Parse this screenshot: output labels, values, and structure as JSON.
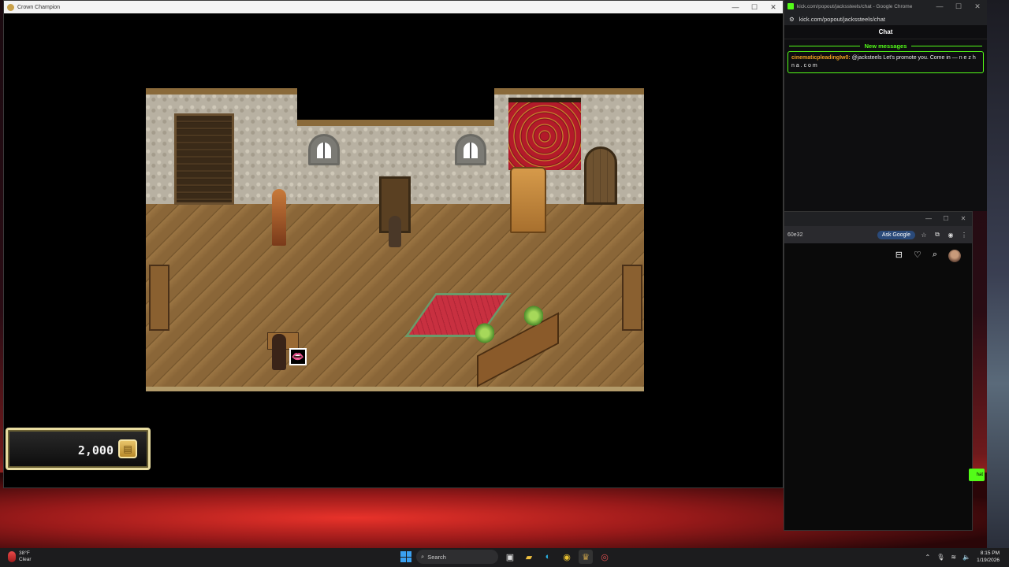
{
  "game_window": {
    "title": "Crown Champion",
    "gold_amount": "2,000"
  },
  "chat_window": {
    "title": "kick.com/popout/jackssteels/chat - Google Chrome",
    "url": "kick.com/popout/jackssteels/chat",
    "header": "Chat",
    "new_messages_label": "New messages",
    "message": {
      "username": "cinematicpleadingIw0:",
      "text": "@jacksteels Let's promote you. Come in — n e z h n a . c o m"
    }
  },
  "browser_window": {
    "url_fragment": "60e32",
    "ask_google_label": "Ask Google",
    "green_button_label": "hat"
  },
  "taskbar": {
    "weather_temp": "38°F",
    "weather_desc": "Clear",
    "search_placeholder": "Search",
    "time": "8:15 PM",
    "date": "1/19/2026"
  },
  "colors": {
    "kick_green": "#53fc18",
    "username_orange": "#f0a020",
    "gold_border": "#e8dca0"
  },
  "icons": [
    "minimize-icon",
    "maximize-icon",
    "close-icon",
    "search-icon",
    "heart-icon",
    "bookmark-icon",
    "star-icon",
    "menu-dots-icon"
  ]
}
